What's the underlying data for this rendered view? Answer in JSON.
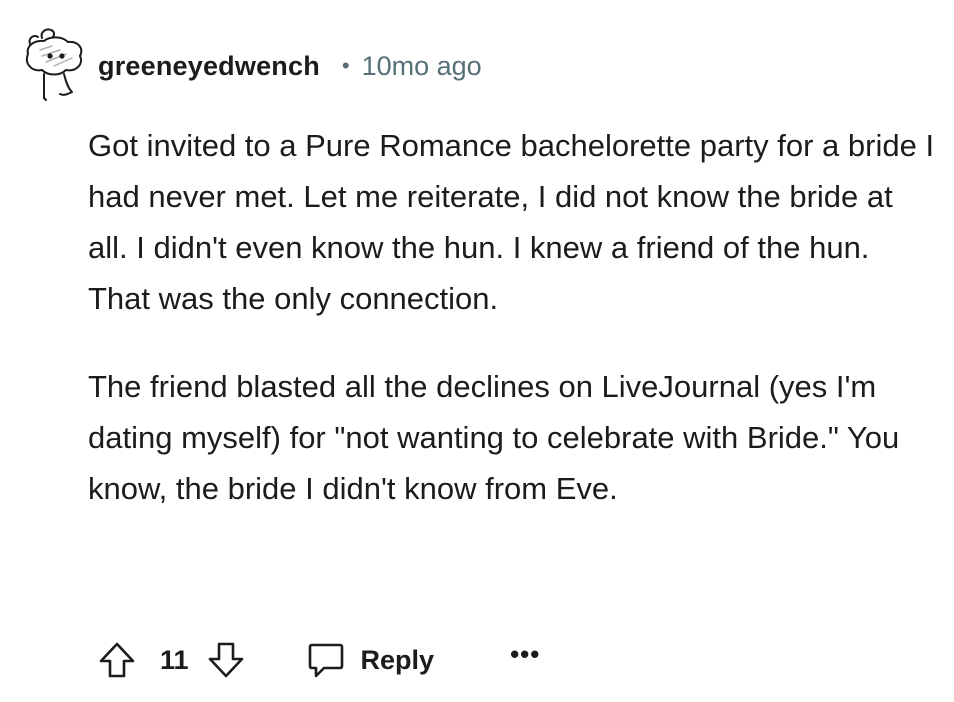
{
  "comment": {
    "avatar_icon": "snoo-avatar-icon",
    "username": "greeneyedwench",
    "separator": "•",
    "timestamp": "10mo ago",
    "paragraphs": [
      "Got invited to a Pure Romance bachelorette party for a bride I had never met. Let me reiterate, I did not know the bride at all. I didn't even know the hun. I knew a friend of the hun. That was the only connection.",
      "The friend blasted all the declines on LiveJournal (yes I'm dating myself) for \"not wanting to celebrate with Bride.\" You know, the bride I didn't know from Eve."
    ],
    "actions": {
      "upvote_icon": "upvote-arrow-icon",
      "vote_count": "11",
      "downvote_icon": "downvote-arrow-icon",
      "reply_icon": "speech-bubble-icon",
      "reply_label": "Reply",
      "more_label": "•••"
    }
  }
}
